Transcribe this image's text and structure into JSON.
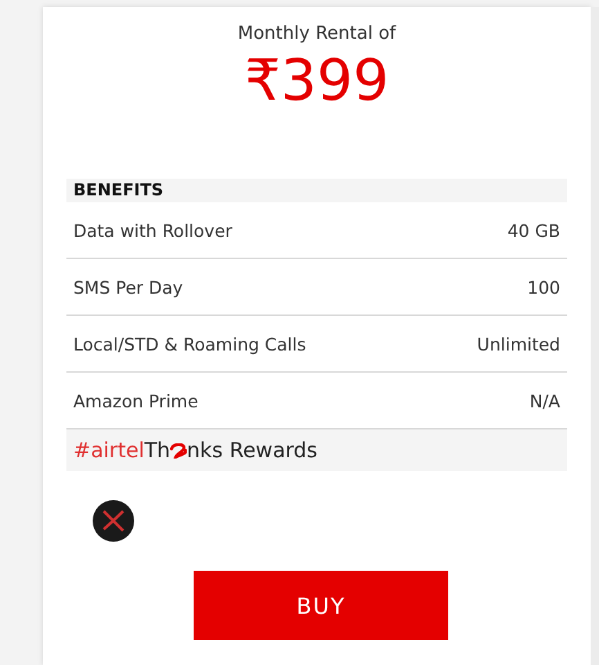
{
  "rental_label": "Monthly Rental of",
  "price": "₹399",
  "benefits": {
    "title": "BENEFITS",
    "rows": [
      {
        "name": "Data with Rollover",
        "value": "40 GB"
      },
      {
        "name": "SMS Per Day",
        "value": "100"
      },
      {
        "name": "Local/STD & Roaming Calls",
        "value": "Unlimited"
      },
      {
        "name": "Amazon Prime",
        "value": "N/A"
      }
    ]
  },
  "rewards": {
    "hashtag": "#airtel",
    "before_logo": "Th",
    "after_logo": "nks Rewards"
  },
  "buy_button": "BUY"
}
